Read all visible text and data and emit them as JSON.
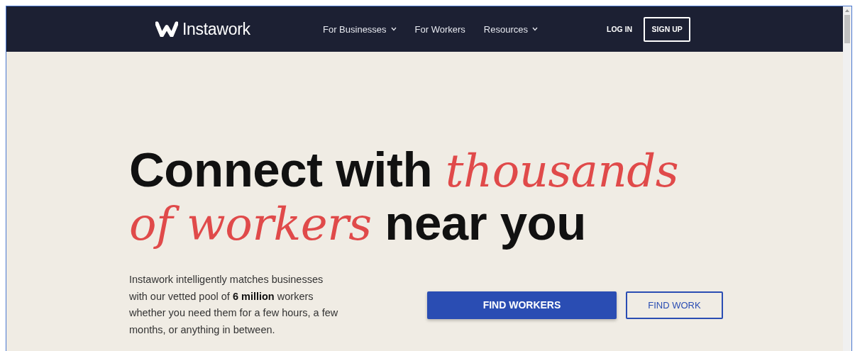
{
  "nav": {
    "logo": "Instawork",
    "links": [
      {
        "label": "For Businesses",
        "has_menu": true
      },
      {
        "label": "For Workers",
        "has_menu": false
      },
      {
        "label": "Resources",
        "has_menu": true
      }
    ],
    "login": "LOG IN",
    "signup": "SIGN UP"
  },
  "hero": {
    "headline": "Connect with *thousands of workers* near you",
    "description": "Instawork intelligently matches businesses with our vetted pool of **6 million** workers whether you need them for a few hours, a few months, or anything in between.",
    "buttons": [
      {
        "label": "FIND WORKERS",
        "kind": "primary"
      },
      {
        "label": "FIND WORK",
        "kind": "outline"
      }
    ]
  }
}
